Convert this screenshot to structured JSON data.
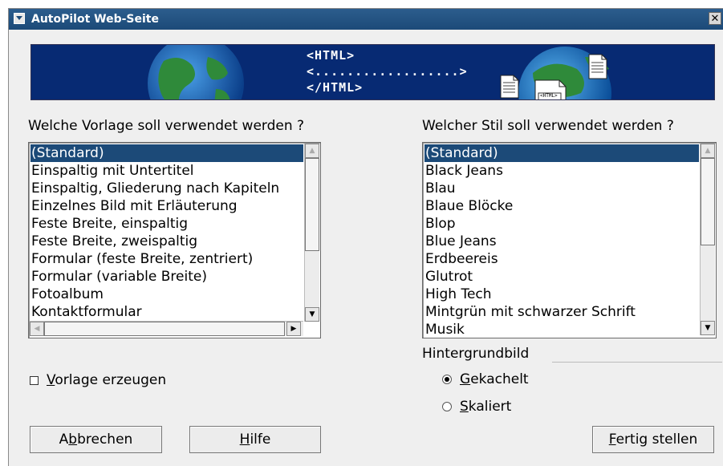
{
  "window": {
    "title": "AutoPilot Web-Seite",
    "close_glyph": "✕"
  },
  "banner": {
    "line1": "<HTML>",
    "line2": "<..................>",
    "line3": "</HTML>",
    "doc_tag": "<HTML>"
  },
  "template_section": {
    "label": "Welche Vorlage soll verwendet werden ?",
    "selected": "(Standard)",
    "items": [
      "(Standard)",
      "Einspaltig mit Untertitel",
      "Einspaltig, Gliederung nach Kapiteln",
      "Einzelnes Bild mit Erläuterung",
      "Feste Breite, einspaltig",
      "Feste Breite, zweispaltig",
      "Formular (feste Breite, zentriert)",
      "Formular (variable Breite)",
      "Fotoalbum",
      "Kontaktformular"
    ]
  },
  "style_section": {
    "label": "Welcher Stil soll verwendet werden ?",
    "selected": "(Standard)",
    "items": [
      "(Standard)",
      "Black Jeans",
      "Blau",
      "Blaue Blöcke",
      "Blop",
      "Blue Jeans",
      "Erdbeereis",
      "Glutrot",
      "High Tech",
      "Mintgrün mit schwarzer Schrift",
      "Musik"
    ]
  },
  "background_image": {
    "label": "Hintergrundbild",
    "options": [
      {
        "first": "G",
        "rest": "ekachelt",
        "selected": true
      },
      {
        "first": "S",
        "rest": "kaliert",
        "selected": false
      }
    ]
  },
  "create_template": {
    "first": "V",
    "rest": "orlage erzeugen",
    "checked": false
  },
  "buttons": {
    "cancel": {
      "pre": "A",
      "u": "b",
      "post": "brechen"
    },
    "help": {
      "pre": "",
      "u": "H",
      "post": "ilfe"
    },
    "finish": {
      "pre": "",
      "u": "F",
      "post": "ertig stellen"
    }
  },
  "scroll_glyphs": {
    "up": "▲",
    "down": "▼",
    "left": "◀",
    "right": "▶"
  },
  "colors": {
    "selection": "#1c4a78",
    "banner_bg": "#072a73",
    "titlebar": "#1c4a78"
  }
}
